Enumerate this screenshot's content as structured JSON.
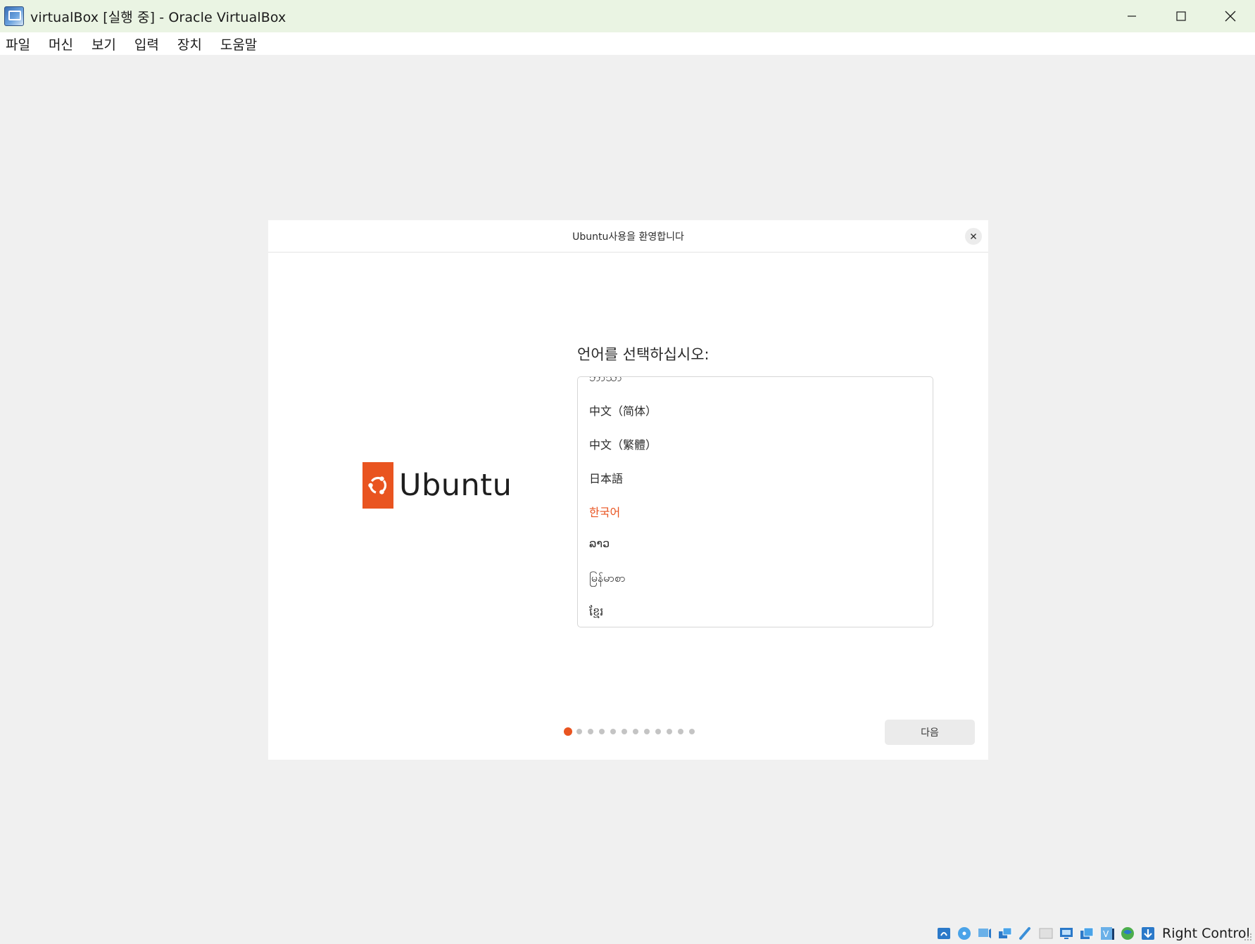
{
  "window": {
    "title": "virtualBox [실행 중] - Oracle VirtualBox",
    "app_icon": "virtualbox-vm-icon",
    "controls": [
      "minimize-icon",
      "maximize-icon",
      "close-icon"
    ]
  },
  "menubar": {
    "items": [
      "파일",
      "머신",
      "보기",
      "입력",
      "장치",
      "도움말"
    ]
  },
  "dialog": {
    "title": "Ubuntu사용을 환영합니다",
    "close_icon": "close-icon",
    "logo_text": "Ubuntu",
    "logo_icon": "ubuntu-circle-of-friends-icon",
    "heading": "언어를 선택하십시오:",
    "languages": {
      "partial_top": "ဘာသာ",
      "items": [
        "中文（简体）",
        "中文（繁體）",
        "日本語",
        "한국어",
        "ລາວ",
        "မြန်မာစာ",
        "ខ្មែរ"
      ],
      "selected": "한국어"
    },
    "pager": {
      "total_pages": 12,
      "current_page": 1
    },
    "next_label": "다음"
  },
  "colors": {
    "accent": "#e95420",
    "titlebar_bg": "#eaf4e3",
    "vm_bg": "#f0f0f0"
  },
  "statusbar": {
    "icons": [
      "hard-disk-icon",
      "optical-disc-icon",
      "audio-icon",
      "network-icon",
      "usb-icon",
      "shared-folder-icon",
      "display-icon",
      "capture-icon",
      "virtualization-icon",
      "cpu-icon",
      "mouse-integration-icon"
    ],
    "host_key": "Right Control"
  }
}
